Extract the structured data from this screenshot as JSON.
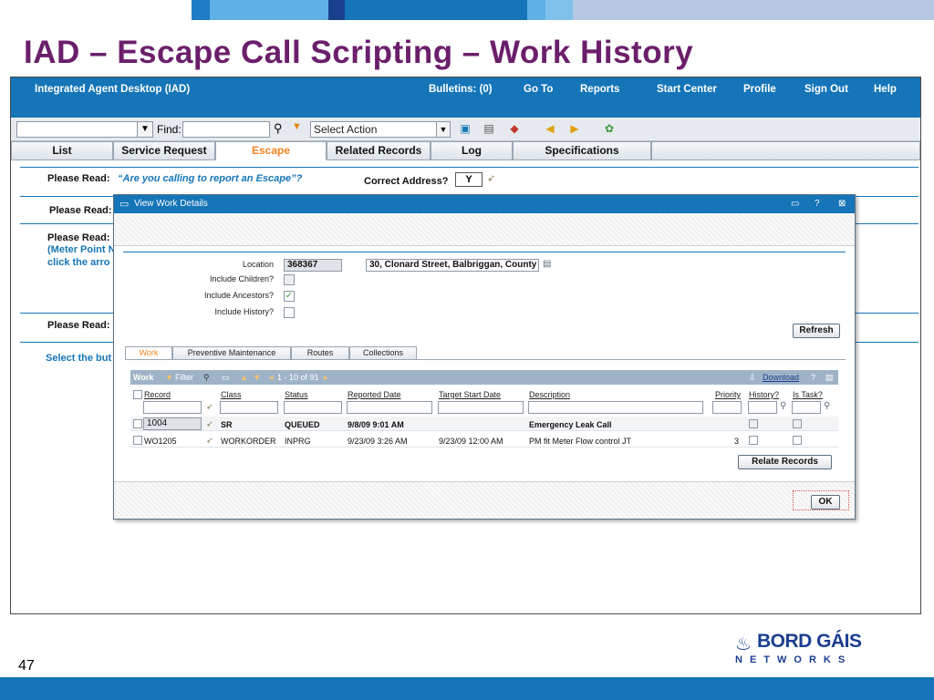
{
  "colors": {
    "title": "#6b1f6b",
    "header": "#1575b8",
    "active_tab": "#f5821f",
    "band1": "#1a3f8f",
    "band2": "#5fb0e6",
    "band3": "#b7c9e2"
  },
  "slide": {
    "title": "IAD – Escape Call Scripting – Work History",
    "page_number": "47"
  },
  "logo": {
    "line1": "BORD GÁIS",
    "line2": "NETWORKS"
  },
  "header": {
    "app_name": "Integrated Agent Desktop (IAD)",
    "bulletins": "Bulletins: (0)",
    "goto": "Go To",
    "reports": "Reports",
    "start_center": "Start Center",
    "profile": "Profile",
    "sign_out": "Sign Out",
    "help": "Help"
  },
  "toolbar": {
    "find_label": "Find:",
    "action_select": "Select Action",
    "icons": [
      "binoculars-icon",
      "new-record-icon",
      "save-icon",
      "clear-icon",
      "previous-icon",
      "next-icon",
      "refresh-icon"
    ]
  },
  "tabs": [
    "List",
    "Service Request",
    "Escape",
    "Related Records",
    "Log",
    "Specifications"
  ],
  "active_tab": "Escape",
  "main": {
    "row1_label": "Please Read:",
    "row1_question": "“Are you calling to report an Escape”?",
    "correct_address_label": "Correct Address?",
    "correct_address_value": "Y",
    "row2_label": "Please Read:",
    "row3_label": "Please Read:",
    "row3_line2": "(Meter Point N",
    "row3_line3": "click the arro",
    "row4_label": "Please Read:",
    "row5_text": "Select the but"
  },
  "modal": {
    "title": "View Work Details",
    "location_label": "Location",
    "location_value": "368367",
    "location_desc": "30, Clonard Street, Balbriggan, County",
    "include_children": "Include Children?",
    "include_ancestors": "Include Ancestors?",
    "include_history": "Include History?",
    "ancestors_checked": "✓",
    "refresh_button": "Refresh",
    "subtabs": [
      "Work",
      "Preventive Maintenance",
      "Routes",
      "Collections"
    ],
    "grid_title": "Work",
    "grid_filter": "Filter",
    "grid_pager": "1 - 10 of 91",
    "grid_download": "Download",
    "columns": [
      "Record",
      "Class",
      "Status",
      "Reported Date",
      "Target Start Date",
      "Description",
      "Priority",
      "History?",
      "Is Task?"
    ],
    "rows": [
      {
        "record": "1004",
        "class": "SR",
        "status": "QUEUED",
        "reported": "9/8/09 9:01 AM",
        "target": "",
        "description": "Emergency Leak Call",
        "priority": ""
      },
      {
        "record": "WO1205",
        "class": "WORKORDER",
        "status": "INPRG",
        "reported": "9/23/09 3:26 AM",
        "target": "9/23/09 12:00 AM",
        "description": "PM fit Meter Flow control JT",
        "priority": "3"
      }
    ],
    "relate_button": "Relate Records",
    "ok_button": "OK"
  }
}
